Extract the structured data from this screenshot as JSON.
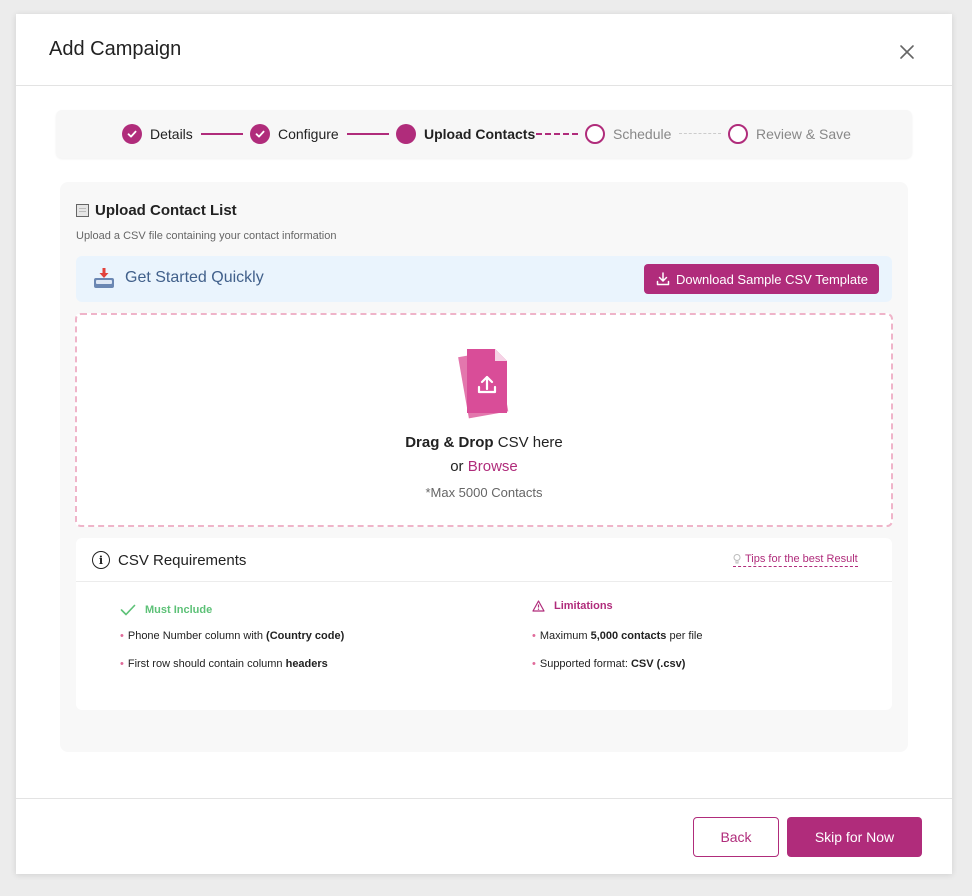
{
  "modal": {
    "title": "Add Campaign"
  },
  "stepper": {
    "steps": [
      {
        "label": "Details",
        "state": "done"
      },
      {
        "label": "Configure",
        "state": "done"
      },
      {
        "label": "Upload Contacts",
        "state": "current"
      },
      {
        "label": "Schedule",
        "state": "todo"
      },
      {
        "label": "Review & Save",
        "state": "todo"
      }
    ]
  },
  "upload": {
    "title": "Upload Contact List",
    "subtitle": "Upload a CSV file containing your contact information",
    "banner": {
      "title": "Get Started Quickly",
      "button_label": "Download Sample CSV Template"
    },
    "dropzone": {
      "bold_text": "Drag & Drop",
      "text_after": " CSV here",
      "or_text": "or ",
      "browse_label": "Browse",
      "note": "*Max 5000 Contacts"
    }
  },
  "requirements": {
    "title": "CSV Requirements",
    "tips_label": "Tips for the best Result",
    "must_include": {
      "heading": "Must Include",
      "items": [
        {
          "text": "Phone Number column with ",
          "bold": "(Country code)",
          "after": ""
        },
        {
          "text": "First row should contain column ",
          "bold": "headers",
          "after": ""
        }
      ]
    },
    "limitations": {
      "heading": "Limitations",
      "items": [
        {
          "text": "Maximum ",
          "bold": "5,000 contacts",
          "after": " per file"
        },
        {
          "text": "Supported format: ",
          "bold": "CSV (.csv)",
          "after": ""
        }
      ]
    }
  },
  "footer": {
    "back_label": "Back",
    "skip_label": "Skip for Now"
  },
  "colors": {
    "accent": "#b02c7b",
    "success": "#5dc177",
    "banner_bg": "#eaf4fd",
    "banner_text": "#41608b",
    "dropzone_border": "#efb4c9"
  }
}
